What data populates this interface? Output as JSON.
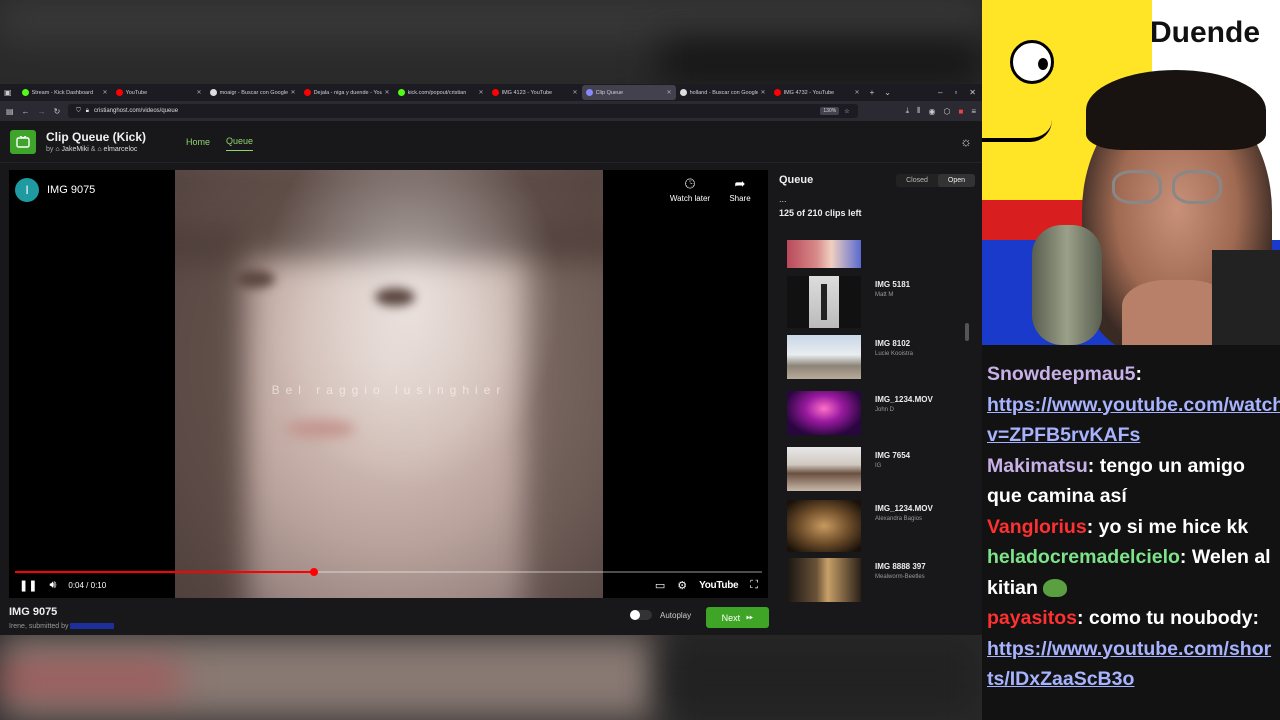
{
  "browser": {
    "tabs": [
      {
        "title": "Stream - Kick Dashboard",
        "color": "#53fc18"
      },
      {
        "title": "YouTube",
        "color": "#ff0000"
      },
      {
        "title": "moaigr - Buscar con Google",
        "color": "#dddddd"
      },
      {
        "title": "Dejala - niga y duende - YouTube",
        "color": "#ff0000"
      },
      {
        "title": "kick.com/popout/cristian",
        "color": "#53fc18"
      },
      {
        "title": "IMG 4123 - YouTube",
        "color": "#ff0000"
      },
      {
        "title": "Clip Queue",
        "color": "#8888ff"
      },
      {
        "title": "holland - Buscar con Google",
        "color": "#dddddd"
      },
      {
        "title": "IMG 4732 - YouTube",
        "color": "#ff0000"
      }
    ],
    "url": "cristianghost.com/videos/queue",
    "zoom": "130%"
  },
  "app": {
    "title": "Clip Queue (Kick)",
    "by_prefix": "by",
    "author1": "JakeMiki",
    "author_sep": "&",
    "author2": "elmarceloc",
    "nav": {
      "home": "Home",
      "queue": "Queue"
    }
  },
  "player": {
    "channel_initial": "I",
    "channel_title": "IMG 9075",
    "watch_later": "Watch later",
    "share": "Share",
    "caption": "Bel raggio lusinghier",
    "time": "0:04 / 0:10",
    "progress": 0.4,
    "brand": "YouTube"
  },
  "clip": {
    "title": "IMG 9075",
    "subtitle": "Irene, submitted by"
  },
  "autoplay_label": "Autoplay",
  "next_label": "Next",
  "queue": {
    "title": "Queue",
    "closed": "Closed",
    "open": "Open",
    "more": "...",
    "count": "125 of 210 clips left",
    "items": [
      {
        "title": "",
        "by": ""
      },
      {
        "title": "IMG 5181",
        "by": "Matt M"
      },
      {
        "title": "IMG 8102",
        "by": "Lucie Kooistra"
      },
      {
        "title": "IMG_1234.MOV",
        "by": "John D"
      },
      {
        "title": "IMG 7654",
        "by": "IG"
      },
      {
        "title": "IMG_1234.MOV",
        "by": "Alexandra Bagios"
      },
      {
        "title": "IMG 8888 397",
        "by": "Mealworm-Beetles"
      }
    ]
  },
  "overlay": {
    "banner_text": "Duende",
    "chat": [
      {
        "user": "Snowdeepmau5",
        "user_color": "#c8b0e8",
        "text": "",
        "link": "https://www.youtube.com/watch?v=ZPFB5rvKAFs"
      },
      {
        "user": "Makimatsu",
        "user_color": "#c8b0e8",
        "text": "tengo un amigo que camina así",
        "link": ""
      },
      {
        "user": "Vanglorius",
        "user_color": "#ff3030",
        "text": "yo si me hice kk",
        "link": ""
      },
      {
        "user": "heladocremadelcielo",
        "user_color": "#7de38a",
        "text": "Welen al kitian",
        "link": ""
      },
      {
        "user": "payasitos",
        "user_color": "#ff3030",
        "text": "como tu noubody:",
        "link": "https://www.youtube.com/shorts/IDxZaaScB3o"
      }
    ]
  }
}
